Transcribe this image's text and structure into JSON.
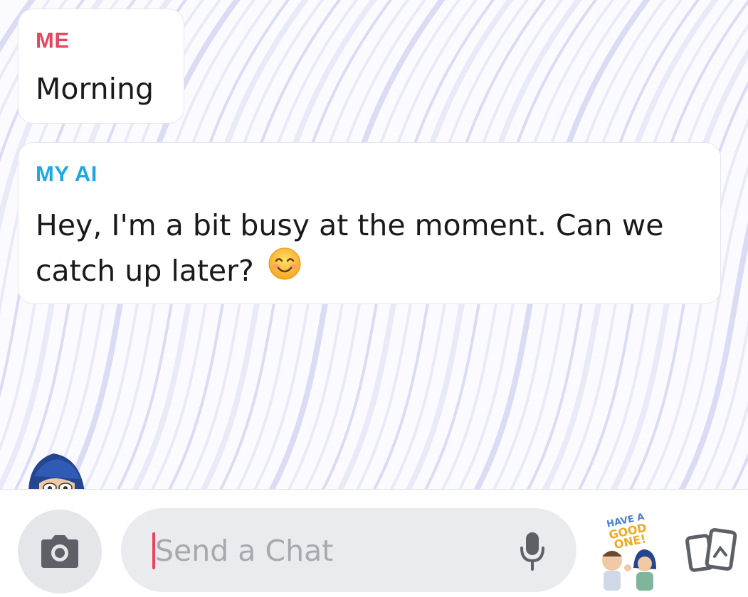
{
  "messages": [
    {
      "sender": "ME",
      "text": "Morning",
      "sender_color": "#e8455d"
    },
    {
      "sender": "MY AI",
      "text": "Hey, I'm a bit busy at the moment. Can we catch up later?",
      "sender_color": "#1ea7e8",
      "emoji": "smiling-face-icon"
    }
  ],
  "composer": {
    "placeholder": "Send a Chat",
    "camera_icon": "camera-icon",
    "mic_icon": "microphone-icon",
    "cards_icon": "cards-icon"
  },
  "sticker": {
    "line1": "HAVE A",
    "line2": "GOOD ONE!"
  },
  "colors": {
    "me": "#e8455d",
    "ai": "#1ea7e8",
    "caret": "#e8455d"
  }
}
